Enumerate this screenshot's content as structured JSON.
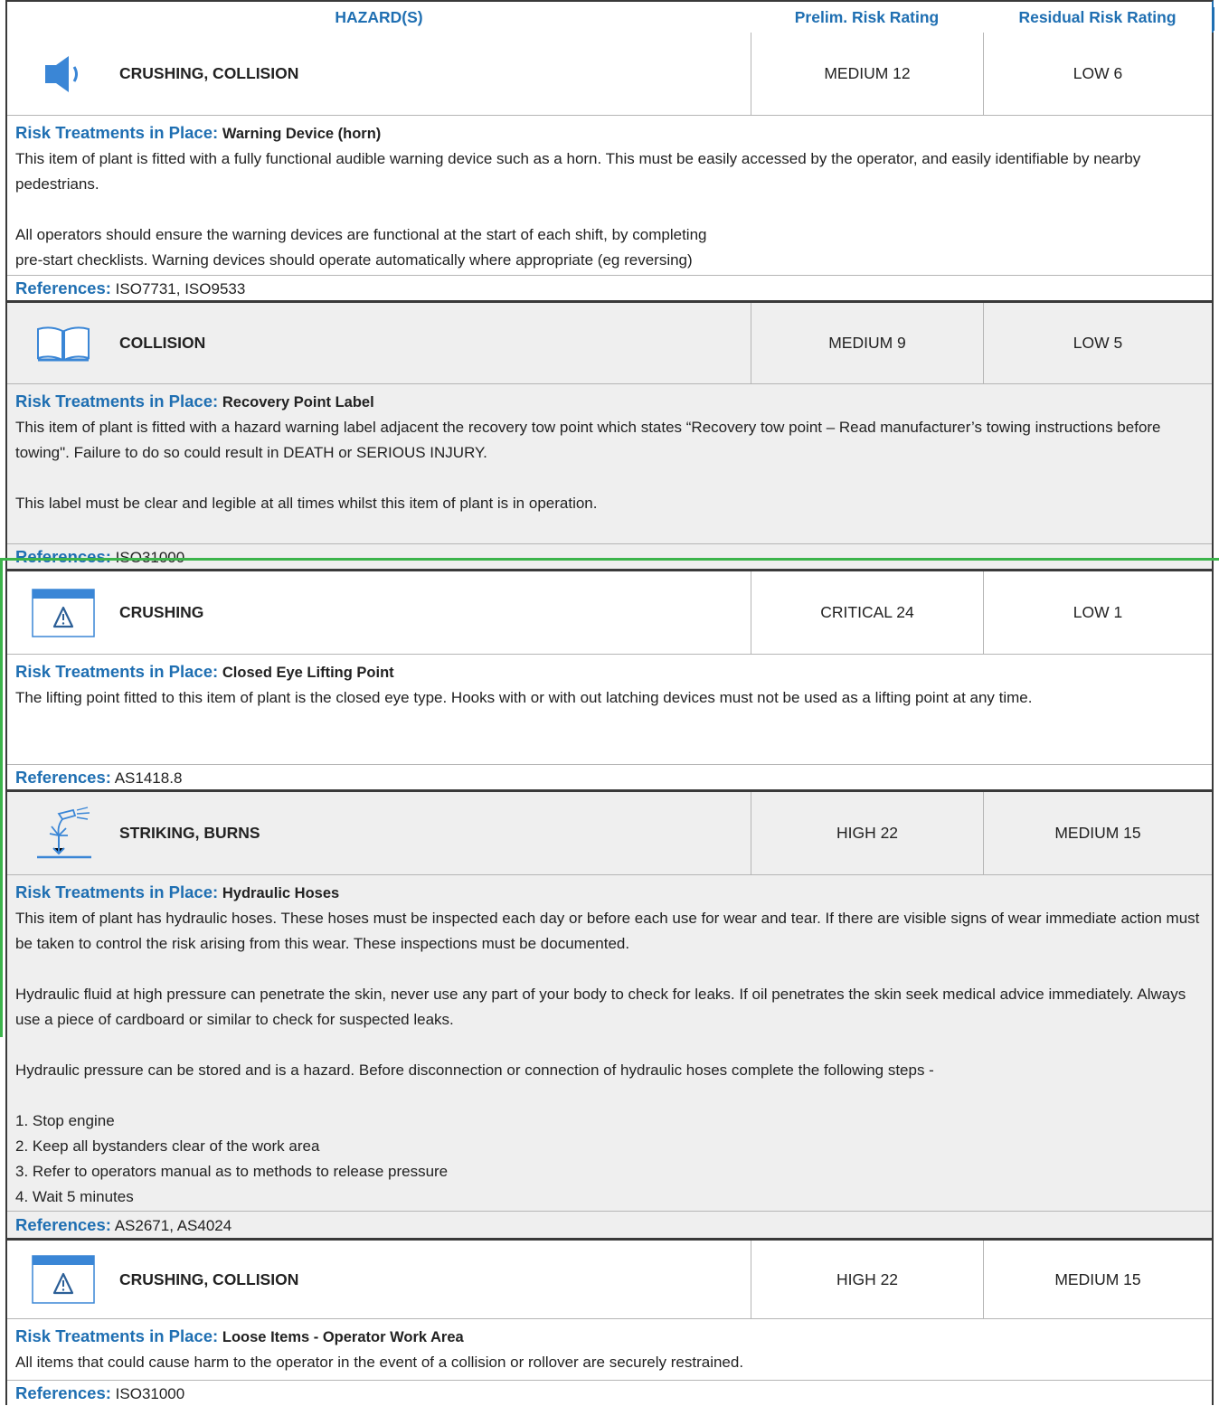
{
  "header": {
    "hazards": "HAZARD(S)",
    "prelim": "Prelim. Risk Rating",
    "residual": "Residual Risk Rating"
  },
  "labels": {
    "treatments": "Risk Treatments in Place:",
    "references": "References:"
  },
  "blocks": [
    {
      "icon": "speaker-icon",
      "hazard": "CRUSHING, COLLISION",
      "prelim": "MEDIUM 12",
      "residual": "LOW 6",
      "treatment": "Warning Device (horn)",
      "paragraphs": [
        "This item of plant is fitted with a fully functional audible warning device such as a horn. This must be easily accessed by the operator, and easily identifiable by nearby pedestrians.",
        "",
        "All operators should ensure the warning devices are functional at the start of each shift, by completing",
        "pre-start checklists. Warning devices should operate automatically where appropriate (eg reversing)"
      ],
      "references": "ISO7731, ISO9533"
    },
    {
      "icon": "book-icon",
      "hazard": "COLLISION",
      "prelim": "MEDIUM 9",
      "residual": "LOW 5",
      "treatment": "Recovery Point Label",
      "paragraphs": [
        "This item of plant is fitted with a hazard warning label adjacent the recovery tow point which states “Recovery tow point – Read manufacturer’s towing instructions before towing\". Failure to do so could result in DEATH or SERIOUS INJURY.",
        "",
        "This label must be clear and legible at all times whilst this item of plant is in operation."
      ],
      "references": "ISO31000"
    },
    {
      "icon": "warning-sign-icon",
      "hazard": "CRUSHING",
      "prelim": "CRITICAL 24",
      "residual": "LOW 1",
      "treatment": "Closed Eye Lifting Point",
      "paragraphs": [
        "The lifting point fitted to this item of plant is the closed eye type. Hooks with or with out latching devices must not be used as a lifting point at any time."
      ],
      "references": "AS1418.8"
    },
    {
      "icon": "hydraulic-spray-icon",
      "hazard": "STRIKING, BURNS",
      "prelim": "HIGH 22",
      "residual": "MEDIUM 15",
      "treatment": "Hydraulic Hoses",
      "paragraphs": [
        "This item of plant has hydraulic hoses. These hoses must be inspected each day or before each use for wear and tear. If there are visible signs of wear immediate action must be taken to control the risk arising from this wear. These inspections must be documented.",
        "",
        "Hydraulic fluid at high pressure can penetrate the skin, never use any part of your body to check for leaks. If oil penetrates the skin seek medical advice immediately. Always use a piece of cardboard or similar to check for suspected leaks.",
        "",
        "Hydraulic pressure can be stored and is a hazard. Before disconnection or connection of hydraulic hoses complete the following steps -",
        "",
        "1. Stop engine",
        "2. Keep all bystanders clear of the work area",
        "3. Refer to operators manual as to methods to release pressure",
        "4. Wait 5 minutes"
      ],
      "references": "AS2671, AS4024"
    },
    {
      "icon": "warning-sign-icon",
      "hazard": "CRUSHING, COLLISION",
      "prelim": "HIGH 22",
      "residual": "MEDIUM 15",
      "treatment": "Loose Items - Operator Work Area",
      "paragraphs": [
        "All items that could cause harm to the operator in the event of a collision or rollover are securely restrained."
      ],
      "references": "ISO31000"
    }
  ]
}
